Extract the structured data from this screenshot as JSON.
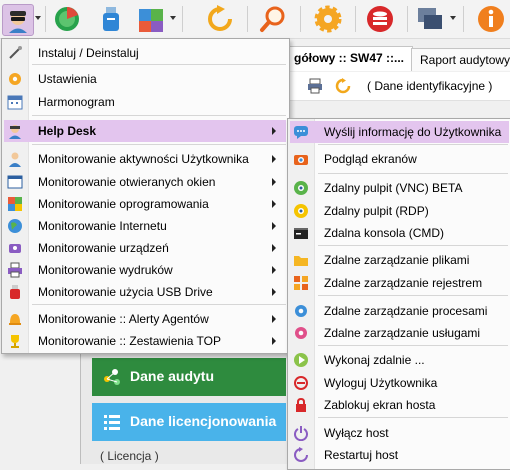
{
  "toolbar": {
    "buttons": [
      {
        "name": "agent-icon"
      },
      {
        "name": "radar-icon"
      },
      {
        "name": "usb-drive-icon"
      },
      {
        "name": "puzzle-icon"
      },
      {
        "name": "refresh-icon"
      },
      {
        "name": "search-icon"
      },
      {
        "name": "gear-icon"
      },
      {
        "name": "database-icon"
      },
      {
        "name": "windows-icon"
      },
      {
        "name": "info-icon"
      }
    ]
  },
  "tabs": {
    "active": "gółowy :: SW47 ::...",
    "other": "Raport audytowy"
  },
  "subbar": {
    "ident": "( Dane identyfikacyjne )"
  },
  "left_panel": {
    "audit_label": "Dane audytu",
    "license_label": "Dane licencjonowania",
    "license_footer": "( Licencja )"
  },
  "main_menu": {
    "items": [
      {
        "label": "Instaluj / Deinstaluj",
        "icon": "install-icon"
      },
      {
        "label": "Ustawienia",
        "icon": "settings-icon"
      },
      {
        "label": "Harmonogram",
        "icon": "calendar-icon"
      },
      {
        "label": "Help Desk",
        "icon": "helpdesk-icon"
      },
      {
        "label": "Monitorowanie aktywności Użytkownika",
        "icon": "user-activity-icon"
      },
      {
        "label": "Monitorowanie otwieranych okien",
        "icon": "window-icon"
      },
      {
        "label": "Monitorowanie oprogramowania",
        "icon": "software-icon"
      },
      {
        "label": "Monitorowanie Internetu",
        "icon": "globe-icon"
      },
      {
        "label": "Monitorowanie urządzeń",
        "icon": "devices-icon"
      },
      {
        "label": "Monitorowanie wydruków",
        "icon": "printer-icon"
      },
      {
        "label": "Monitorowanie użycia USB Drive",
        "icon": "usb-icon"
      },
      {
        "label": "Monitorowanie :: Alerty Agentów",
        "icon": "bell-icon"
      },
      {
        "label": "Monitorowanie :: Zestawienia TOP",
        "icon": "trophy-icon"
      }
    ]
  },
  "submenu": {
    "items": [
      {
        "label": "Wyślij informację do Użytkownika",
        "icon": "message-icon"
      },
      {
        "label": "Podgląd ekranów",
        "icon": "camera-icon"
      },
      {
        "label": "Zdalny pulpit (VNC) BETA",
        "icon": "vnc-icon"
      },
      {
        "label": "Zdalny pulpit (RDP)",
        "icon": "rdp-icon"
      },
      {
        "label": "Zdalna konsola (CMD)",
        "icon": "console-icon"
      },
      {
        "label": "Zdalne zarządzanie plikami",
        "icon": "folder-icon"
      },
      {
        "label": "Zdalne zarządzanie rejestrem",
        "icon": "registry-icon"
      },
      {
        "label": "Zdalne zarządzanie procesami",
        "icon": "process-icon"
      },
      {
        "label": "Zdalne zarządzanie usługami",
        "icon": "services-icon"
      },
      {
        "label": "Wykonaj zdalnie ...",
        "icon": "run-icon"
      },
      {
        "label": "Wyloguj Użytkownika",
        "icon": "logout-icon"
      },
      {
        "label": "Zablokuj ekran hosta",
        "icon": "lock-icon"
      },
      {
        "label": "Wyłącz host",
        "icon": "power-icon"
      },
      {
        "label": "Restartuj host",
        "icon": "restart-icon"
      }
    ]
  },
  "colors": {
    "highlight": "#e3c5ee",
    "audit_green": "#2e8b3e",
    "license_blue": "#49b3ea"
  }
}
